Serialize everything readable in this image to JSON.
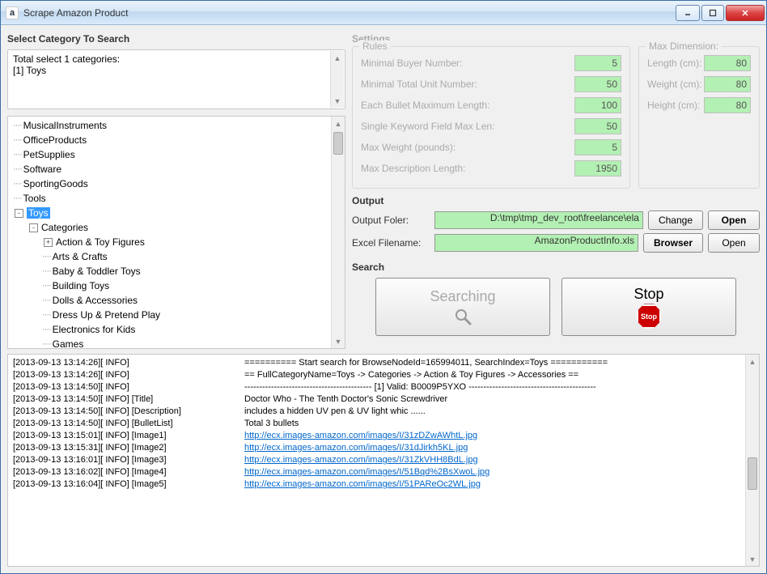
{
  "window": {
    "title": "Scrape Amazon Product"
  },
  "category": {
    "heading": "Select Category To Search",
    "summary_line1": "Total select 1 categories:",
    "summary_line2": "[1] Toys",
    "tree": [
      {
        "label": "MusicalInstruments",
        "indent": 1
      },
      {
        "label": "OfficeProducts",
        "indent": 1
      },
      {
        "label": "PetSupplies",
        "indent": 1
      },
      {
        "label": "Software",
        "indent": 1
      },
      {
        "label": "SportingGoods",
        "indent": 1
      },
      {
        "label": "Tools",
        "indent": 1
      },
      {
        "label": "Toys",
        "indent": 1,
        "pm": "-",
        "selected": true
      },
      {
        "label": "Categories",
        "indent": 2,
        "pm": "-"
      },
      {
        "label": "Action & Toy Figures",
        "indent": 3,
        "pm": "+"
      },
      {
        "label": "Arts & Crafts",
        "indent": 3
      },
      {
        "label": "Baby & Toddler Toys",
        "indent": 3
      },
      {
        "label": "Building Toys",
        "indent": 3
      },
      {
        "label": "Dolls & Accessories",
        "indent": 3
      },
      {
        "label": "Dress Up & Pretend Play",
        "indent": 3
      },
      {
        "label": "Electronics for Kids",
        "indent": 3
      },
      {
        "label": "Games",
        "indent": 3
      }
    ]
  },
  "settings": {
    "heading": "Settings",
    "rules_title": "Rules",
    "dim_title": "Max Dimension:",
    "rules": [
      {
        "label": "Minimal Buyer Number:",
        "value": "5"
      },
      {
        "label": "Minimal Total Unit Number:",
        "value": "50"
      },
      {
        "label": "Each Bullet Maximum Length:",
        "value": "100"
      },
      {
        "label": "Single Keyword Field Max Len:",
        "value": "50"
      },
      {
        "label": "Max Weight (pounds):",
        "value": "5"
      },
      {
        "label": "Max Description Length:",
        "value": "1950"
      }
    ],
    "dims": [
      {
        "label": "Length (cm):",
        "value": "80"
      },
      {
        "label": "Weight (cm):",
        "value": "80"
      },
      {
        "label": "Height (cm):",
        "value": "80"
      }
    ]
  },
  "output": {
    "heading": "Output",
    "folder_label": "Output Foler:",
    "folder_value": "D:\\tmp\\tmp_dev_root\\freelance\\ela",
    "excel_label": "Excel Filename:",
    "excel_value": "AmazonProductInfo.xls",
    "btn_change": "Change",
    "btn_open": "Open",
    "btn_browser": "Browser"
  },
  "search": {
    "heading": "Search",
    "searching": "Searching",
    "stop": "Stop",
    "stop_icon_text": "Stop"
  },
  "log": {
    "lines": [
      {
        "prefix": "[2013-09-13 13:14:26][ INFO] ",
        "text": "========== Start search for BrowseNodeId=165994011, SearchIndex=Toys ==========="
      },
      {
        "prefix": "[2013-09-13 13:14:26][ INFO] ",
        "text": "== FullCategoryName=Toys -> Categories -> Action & Toy Figures -> Accessories =="
      },
      {
        "prefix": "[2013-09-13 13:14:50][ INFO] ",
        "text": "------------------------------------------- [1] Valid: B0009P5YXO -------------------------------------------"
      },
      {
        "prefix": "[2013-09-13 13:14:50][ INFO] [Title]",
        "text": "Doctor Who - The Tenth Doctor's Sonic Screwdriver"
      },
      {
        "prefix": "[2013-09-13 13:14:50][ INFO] [Description]",
        "text": "includes a hidden UV pen & UV light whic ......"
      },
      {
        "prefix": "[2013-09-13 13:14:50][ INFO] [BulletList]",
        "text": "Total 3 bullets"
      },
      {
        "prefix": "[2013-09-13 13:15:01][ INFO] [Image1]",
        "link": "http://ecx.images-amazon.com/images/I/31zDZwAWhtL.jpg"
      },
      {
        "prefix": "[2013-09-13 13:15:31][ INFO] [Image2]",
        "link": "http://ecx.images-amazon.com/images/I/31dJirkh5KL.jpg"
      },
      {
        "prefix": "[2013-09-13 13:16:01][ INFO] [Image3]",
        "link": "http://ecx.images-amazon.com/images/I/31ZkVHH8BdL.jpg"
      },
      {
        "prefix": "[2013-09-13 13:16:02][ INFO] [Image4]",
        "link": "http://ecx.images-amazon.com/images/I/51Bqd%2BsXwoL.jpg"
      },
      {
        "prefix": "[2013-09-13 13:16:04][ INFO] [Image5]",
        "link": "http://ecx.images-amazon.com/images/I/51PAReOc2WL.jpg"
      }
    ]
  }
}
